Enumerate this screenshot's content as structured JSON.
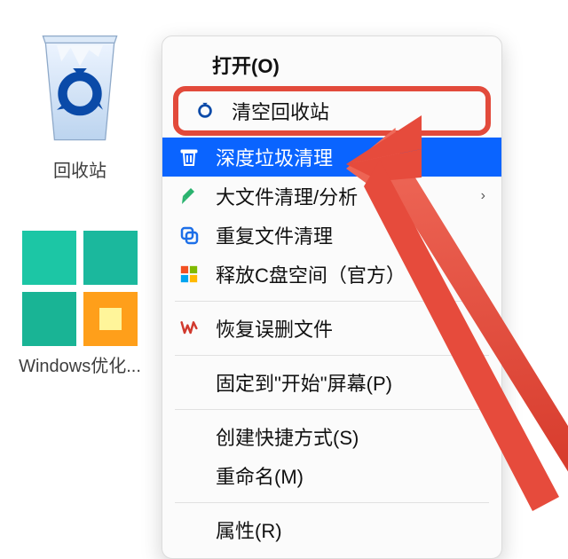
{
  "desktop": {
    "recycle_bin_label": "回收站",
    "win_optimize_label": "Windows优化..."
  },
  "context_menu": {
    "open": "打开(O)",
    "empty_recycle": "清空回收站",
    "deep_clean": "深度垃圾清理",
    "big_file": "大文件清理/分析",
    "dup_clean": "重复文件清理",
    "free_c": "释放C盘空间（官方）",
    "recover": "恢复误删文件",
    "pin_start": "固定到\"开始\"屏幕(P)",
    "create_shortcut": "创建快捷方式(S)",
    "rename": "重命名(M)",
    "properties": "属性(R)"
  },
  "annotations": {
    "highlight_color": "#e24a3b",
    "arrow_color": "#e24a3b",
    "highlighted_item": "empty_recycle",
    "hovered_item": "deep_clean"
  }
}
